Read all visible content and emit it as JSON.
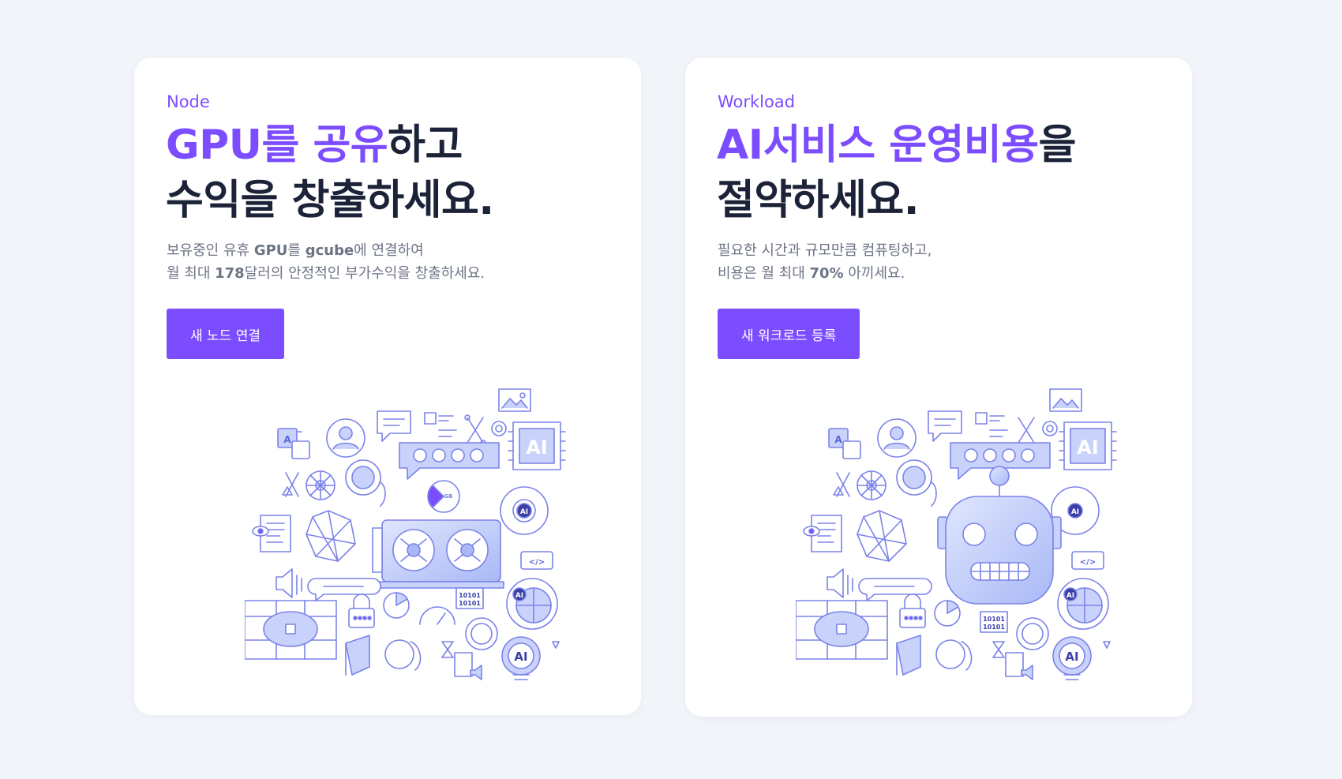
{
  "cards": [
    {
      "eyebrow": "Node",
      "headline": {
        "line1_highlight": "GPU를 공유",
        "line1_rest": "하고",
        "line2": "수익을 창출하세요."
      },
      "description": {
        "line1_parts": [
          "보유중인 유휴 ",
          "GPU",
          "를 ",
          "gcube",
          "에 연결하여"
        ],
        "line2_parts": [
          "월 최대 ",
          "178",
          "달러의 안정적인 부가수익을 창출하세요."
        ]
      },
      "button_label": "새 노드 연결",
      "illustration_icon": "gpu-card-illustration"
    },
    {
      "eyebrow": "Workload",
      "headline": {
        "line1_highlight": "AI서비스 운영비용",
        "line1_rest": "을",
        "line2": "절약하세요."
      },
      "description": {
        "line1_parts": [
          "필요한 시간과 규모만큼 컴퓨팅하고,"
        ],
        "line2_parts": [
          "비용은 월 최대 ",
          "70%",
          " 아끼세요."
        ]
      },
      "button_label": "새 워크로드 등록",
      "illustration_icon": "robot-head-illustration"
    }
  ],
  "illustration_text": {
    "ai": "AI",
    "binary": "10101",
    "gb": "GB",
    "letter_a": "A",
    "code": "</>"
  },
  "colors": {
    "accent": "#7c4dff",
    "headline": "#1c2338",
    "body_text": "#6c7384",
    "page_bg": "#f1f4f9",
    "card_bg": "#ffffff",
    "illustration_stroke": "#7b83e8",
    "illustration_fill": "#c9d2fb"
  }
}
